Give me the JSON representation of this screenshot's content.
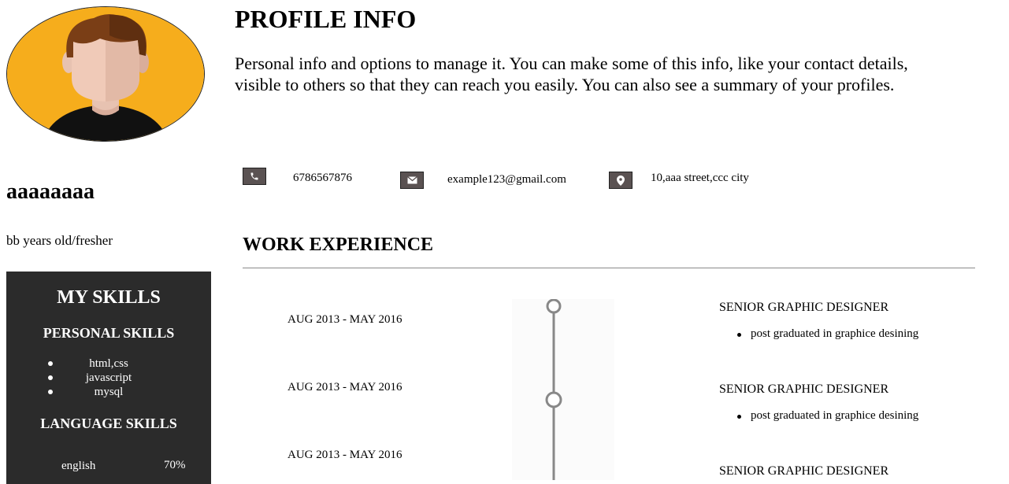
{
  "profile": {
    "name": "aaaaaaaa",
    "age": "bb years old/fresher"
  },
  "skills": {
    "title": "MY SKILLS",
    "personal_title": "PERSONAL SKILLS",
    "personal": [
      "html,css",
      "javascript",
      "mysql"
    ],
    "language_title": "LANGUAGE SKILLS",
    "languages": [
      {
        "name": "english",
        "level": "70%"
      }
    ]
  },
  "header": {
    "title": "PROFILE INFO",
    "description": "Personal info and options to manage it. You can make some of this info, like your contact details, visible to others so that they can reach you easily. You can also see a summary of your profiles."
  },
  "contact": {
    "phone": "6786567876",
    "email": "example123@gmail.com",
    "address": "10,aaa street,ccc city",
    "phone_icon": "phone-icon",
    "email_icon": "envelope-icon",
    "address_icon": "map-pin-icon"
  },
  "work": {
    "title": "WORK EXPERIENCE",
    "items": [
      {
        "date": "AUG 2013 - MAY 2016",
        "role": "SENIOR GRAPHIC DESIGNER",
        "detail": "post graduated in graphice desining"
      },
      {
        "date": "AUG 2013 - MAY 2016",
        "role": "SENIOR GRAPHIC DESIGNER",
        "detail": "post graduated in graphice desining"
      },
      {
        "date": "AUG 2013 - MAY 2016",
        "role": "SENIOR GRAPHIC DESIGNER",
        "detail": ""
      }
    ]
  },
  "colors": {
    "avatar_bg": "#f6ad1c",
    "panel_bg": "#2b2b2b",
    "icon_bg": "#5a5252"
  }
}
